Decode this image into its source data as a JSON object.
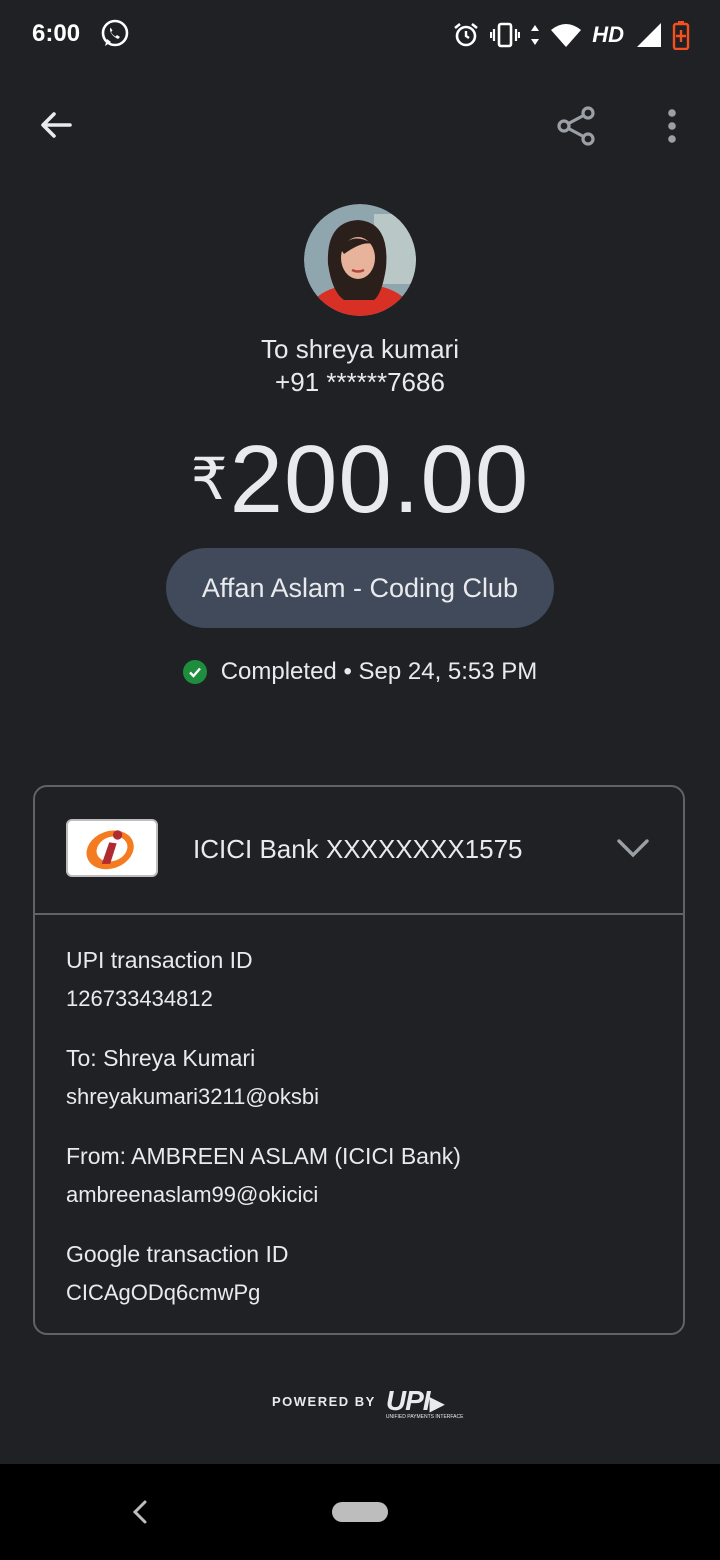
{
  "status_bar": {
    "time": "6:00",
    "network_label": "HD",
    "icons": [
      "whatsapp-icon",
      "alarm-icon",
      "vibrate-icon",
      "data-arrows-icon",
      "wifi-icon",
      "signal-icon",
      "battery-icon"
    ]
  },
  "app_bar": {
    "icons": [
      "back-arrow-icon",
      "share-icon",
      "more-vert-icon"
    ]
  },
  "recipient": {
    "to_line": "To shreya kumari",
    "phone": "+91 ******7686"
  },
  "payment": {
    "currency_symbol": "₹",
    "amount": "200.00",
    "note": "Affan Aslam - Coding Club",
    "status": "Completed",
    "separator": "•",
    "datetime": "Sep 24, 5:53 PM"
  },
  "details_card": {
    "bank_account": "ICICI Bank XXXXXXXX1575",
    "upi_txn_label": "UPI transaction ID",
    "upi_txn_value": "126733434812",
    "to_label": "To: Shreya  Kumari",
    "to_value": "shreyakumari3211@oksbi",
    "from_label": "From: AMBREEN ASLAM (ICICI Bank)",
    "from_value": "ambreenaslam99@okicici",
    "google_txn_label": "Google transaction ID",
    "google_txn_value": "CICAgODq6cmwPg"
  },
  "footer": {
    "powered_by": "POWERED BY",
    "upi_logo": "UPI",
    "upi_subtext": "UNIFIED PAYMENTS INTERFACE"
  },
  "colors": {
    "background": "#202124",
    "chip": "#414a5a",
    "success": "#1e8e3e",
    "battery": "#f4511e",
    "border": "#5f6368"
  }
}
